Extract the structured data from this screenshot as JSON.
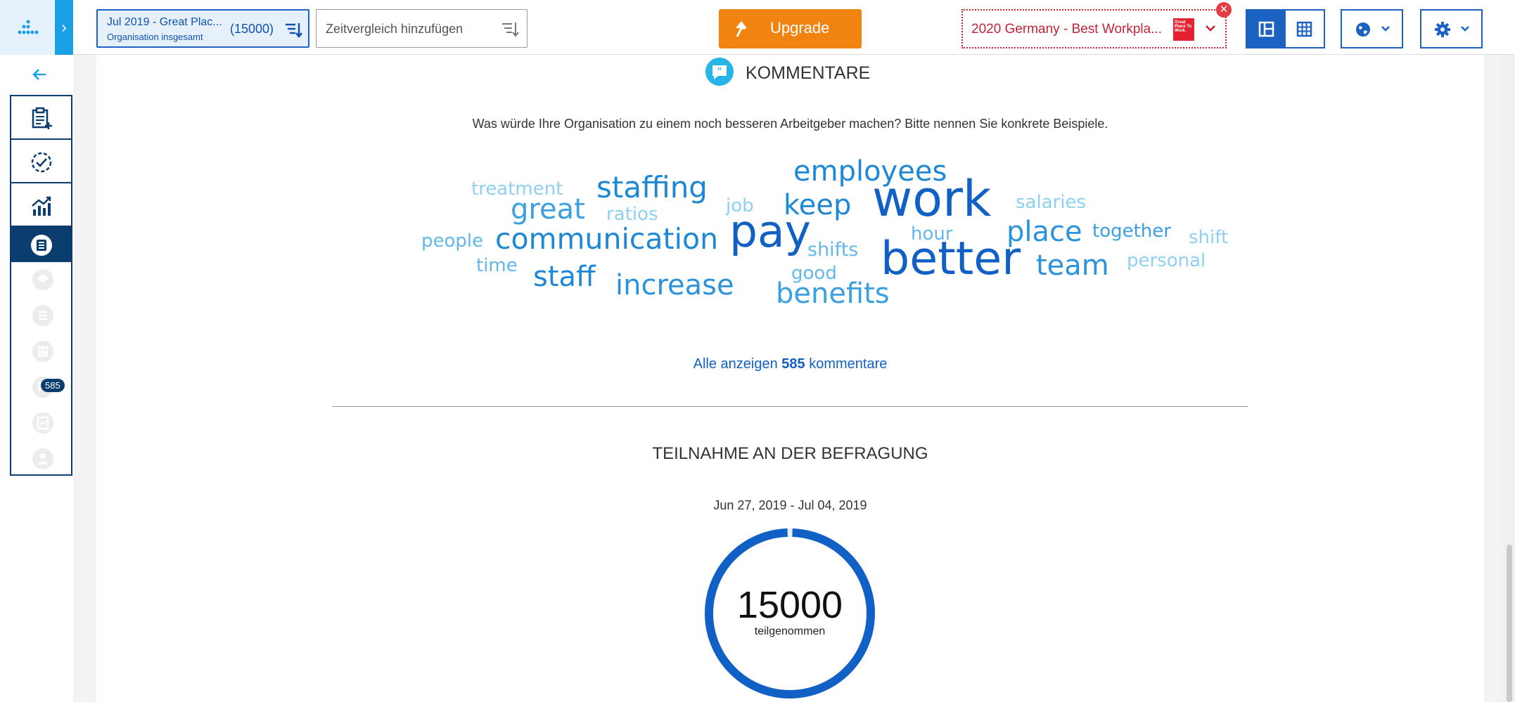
{
  "topbar": {
    "survey": {
      "name": "Jul 2019 - Great Plac...",
      "scope": "Organisation insgesamt",
      "count": "(15000)"
    },
    "compare_placeholder": "Zeitvergleich hinzufügen",
    "upgrade_label": "Upgrade",
    "benchmark_label": "2020 Germany - Best Workpla...",
    "benchmark_logo_text": "Great Place To Work."
  },
  "sidebar": {
    "badge": "585"
  },
  "comments": {
    "title": "KOMMENTARE",
    "question": "Was würde Ihre Organisation zu einem noch besseren Arbeitgeber machen? Bitte nennen Sie konkrete Beispiele.",
    "words": [
      {
        "text": "treatment",
        "color": "#8fd0f2"
      },
      {
        "text": "staffing",
        "color": "#1e88d6"
      },
      {
        "text": "employees",
        "color": "#1e88d6"
      },
      {
        "text": "work",
        "color": "#1060c5"
      },
      {
        "text": "salaries",
        "color": "#8fd0f2"
      },
      {
        "text": "great",
        "color": "#3aa0e0"
      },
      {
        "text": "ratios",
        "color": "#8fd0f2"
      },
      {
        "text": "job",
        "color": "#8fd0f2"
      },
      {
        "text": "keep",
        "color": "#1e88d6"
      },
      {
        "text": "people",
        "color": "#62b8ea"
      },
      {
        "text": "communication",
        "color": "#1e88d6"
      },
      {
        "text": "pay",
        "color": "#1060c5"
      },
      {
        "text": "hour",
        "color": "#62b8ea"
      },
      {
        "text": "place",
        "color": "#2a93dc"
      },
      {
        "text": "together",
        "color": "#3aa0e0"
      },
      {
        "text": "shift",
        "color": "#8fd0f2"
      },
      {
        "text": "shifts",
        "color": "#62b8ea"
      },
      {
        "text": "time",
        "color": "#62b8ea"
      },
      {
        "text": "better",
        "color": "#1060c5"
      },
      {
        "text": "team",
        "color": "#2a93dc"
      },
      {
        "text": "personal",
        "color": "#8fd0f2"
      },
      {
        "text": "staff",
        "color": "#1e88d6"
      },
      {
        "text": "good",
        "color": "#62b8ea"
      },
      {
        "text": "increase",
        "color": "#2a93dc"
      },
      {
        "text": "benefits",
        "color": "#3aa0e0"
      }
    ],
    "show_all_prefix": "Alle anzeigen",
    "show_all_count": "585",
    "show_all_suffix": "kommentare"
  },
  "participation": {
    "title": "TEILNAHME AN DER BEFRAGUNG",
    "date_range": "Jun 27, 2019 - Jul 04, 2019",
    "count": "15000",
    "label": "teilgenommen",
    "ring_fraction": 0.99,
    "ring_color": "#1060c5"
  }
}
